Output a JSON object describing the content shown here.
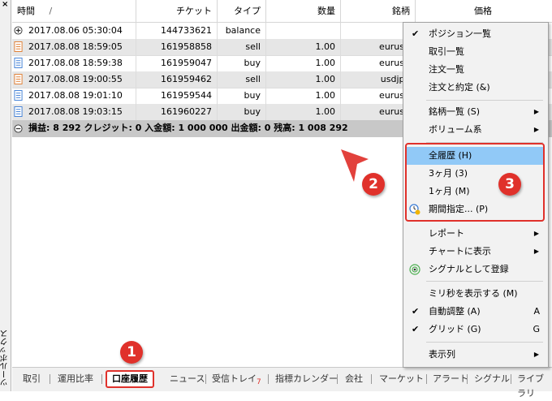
{
  "toolbox": {
    "close_glyph": "×",
    "label": "ツールボックス"
  },
  "table": {
    "headers": [
      "時間",
      "チケット",
      "タイプ",
      "数量",
      "銘柄",
      "価格"
    ],
    "sort_indicator": "/",
    "rows": [
      {
        "icon": "plus-circle-icon",
        "time": "2017.08.06 05:30:04",
        "ticket": "144733621",
        "type": "balance",
        "volume": "",
        "symbol": "",
        "price": ""
      },
      {
        "icon": "sell-document-icon",
        "time": "2017.08.08 18:59:05",
        "ticket": "161958858",
        "type": "sell",
        "volume": "1.00",
        "symbol": "eurusd",
        "price": ""
      },
      {
        "icon": "buy-document-icon",
        "time": "2017.08.08 18:59:38",
        "ticket": "161959047",
        "type": "buy",
        "volume": "1.00",
        "symbol": "eurusd",
        "price": ""
      },
      {
        "icon": "sell-document-icon",
        "time": "2017.08.08 19:00:55",
        "ticket": "161959462",
        "type": "sell",
        "volume": "1.00",
        "symbol": "usdjpy",
        "price": ""
      },
      {
        "icon": "buy-document-icon",
        "time": "2017.08.08 19:01:10",
        "ticket": "161959544",
        "type": "buy",
        "volume": "1.00",
        "symbol": "eurusd",
        "price": ""
      },
      {
        "icon": "buy-document-icon",
        "time": "2017.08.08 19:03:15",
        "ticket": "161960227",
        "type": "buy",
        "volume": "1.00",
        "symbol": "eurusd",
        "price": ""
      }
    ],
    "summary": "損益: 8 292  クレジット: 0  入金額: 1 000 000  出金額: 0  残高: 1 008 292"
  },
  "tabs": [
    {
      "label": "取引"
    },
    {
      "label": "運用比率"
    },
    {
      "label": "口座履歴",
      "active": true
    },
    {
      "label": "ニュース"
    },
    {
      "label": "受信トレイ",
      "badge": "7"
    },
    {
      "label": "指標カレンダー"
    },
    {
      "label": "会社"
    },
    {
      "label": "マーケット"
    },
    {
      "label": "アラート"
    },
    {
      "label": "シグナル"
    },
    {
      "label": "ライブラリ"
    }
  ],
  "menu": {
    "items": [
      {
        "label": "ポジション一覧",
        "checked": true
      },
      {
        "label": "取引一覧"
      },
      {
        "label": "注文一覧"
      },
      {
        "label": "注文と約定 (&)"
      },
      {
        "label": "銘柄一覧 (S)",
        "submenu": true
      },
      {
        "label": "ボリューム系",
        "submenu": true
      },
      {
        "label": "全履歴 (H)",
        "highlighted": true
      },
      {
        "label": "3ヶ月 (3)"
      },
      {
        "label": "1ヶ月 (M)"
      },
      {
        "label": "期間指定... (P)",
        "icon": "calendar-gear-icon"
      },
      {
        "label": "レポート",
        "submenu": true
      },
      {
        "label": "チャートに表示",
        "submenu": true
      },
      {
        "label": "シグナルとして登録",
        "icon": "signal-antenna-icon"
      },
      {
        "label": "ミリ秒を表示する (M)"
      },
      {
        "label": "自動調整 (A)",
        "checked": true,
        "shortcut": "A"
      },
      {
        "label": "グリッド (G)",
        "checked": true,
        "shortcut": "G"
      },
      {
        "label": "表示列",
        "submenu": true
      }
    ]
  },
  "callouts": [
    "1",
    "2",
    "3"
  ],
  "colors": {
    "accent_red": "#e0312b",
    "menu_highlight": "#91c9f7",
    "summary_bg": "#c8c8c8",
    "shaded_row": "#e6e6e6"
  }
}
